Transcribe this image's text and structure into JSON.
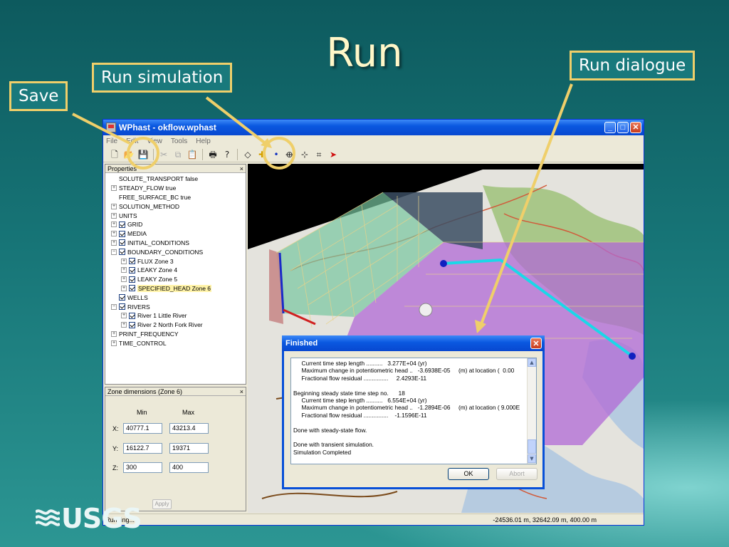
{
  "slide": {
    "title": "Run",
    "callouts": {
      "save": "Save",
      "run_simulation": "Run simulation",
      "run_dialogue": "Run dialogue"
    },
    "logo": "USGS"
  },
  "window": {
    "title": "WPhast - okflow.wphast",
    "menu": [
      "File",
      "Edit",
      "View",
      "Tools",
      "Help"
    ],
    "toolbar_icons": [
      "new-icon",
      "open-icon",
      "save-icon",
      "cut-icon",
      "copy-icon",
      "paste-icon",
      "print-icon",
      "help-icon",
      "zone-icon",
      "add-icon",
      "well-icon",
      "run-icon",
      "river-icon",
      "grid-icon",
      "pointer-icon"
    ]
  },
  "properties": {
    "header": "Properties",
    "close": "×",
    "items": [
      {
        "label": "SOLUTE_TRANSPORT false",
        "toggle": "",
        "checked": false,
        "indent": 0
      },
      {
        "label": "STEADY_FLOW true",
        "toggle": "+",
        "checked": false,
        "indent": 0
      },
      {
        "label": "FREE_SURFACE_BC true",
        "toggle": "",
        "checked": false,
        "indent": 0
      },
      {
        "label": "SOLUTION_METHOD",
        "toggle": "+",
        "checked": false,
        "indent": 0
      },
      {
        "label": "UNITS",
        "toggle": "+",
        "checked": false,
        "indent": 0
      },
      {
        "label": "GRID",
        "toggle": "+",
        "checked": true,
        "indent": 0
      },
      {
        "label": "MEDIA",
        "toggle": "+",
        "checked": true,
        "indent": 0
      },
      {
        "label": "INITIAL_CONDITIONS",
        "toggle": "+",
        "checked": true,
        "indent": 0
      },
      {
        "label": "BOUNDARY_CONDITIONS",
        "toggle": "−",
        "checked": true,
        "indent": 0
      },
      {
        "label": "FLUX Zone 3",
        "toggle": "+",
        "checked": true,
        "indent": 1
      },
      {
        "label": "LEAKY Zone 4",
        "toggle": "+",
        "checked": true,
        "indent": 1
      },
      {
        "label": "LEAKY Zone 5",
        "toggle": "+",
        "checked": true,
        "indent": 1
      },
      {
        "label": "SPECIFIED_HEAD Zone 6",
        "toggle": "+",
        "checked": true,
        "indent": 1,
        "selected": true
      },
      {
        "label": "WELLS",
        "toggle": "",
        "checked": true,
        "indent": 0
      },
      {
        "label": "RIVERS",
        "toggle": "−",
        "checked": true,
        "indent": 0
      },
      {
        "label": "River 1 Little River",
        "toggle": "+",
        "checked": true,
        "indent": 1
      },
      {
        "label": "River 2 North Fork River",
        "toggle": "+",
        "checked": true,
        "indent": 1
      },
      {
        "label": "PRINT_FREQUENCY",
        "toggle": "+",
        "checked": false,
        "indent": 0
      },
      {
        "label": "TIME_CONTROL",
        "toggle": "+",
        "checked": false,
        "indent": 0
      }
    ]
  },
  "zone": {
    "header": "Zone dimensions (Zone 6)",
    "close": "×",
    "min_label": "Min",
    "max_label": "Max",
    "x_label": "X:",
    "y_label": "Y:",
    "z_label": "Z:",
    "x_min": "40777.1",
    "x_max": "43213.4",
    "y_min": "16122.7",
    "y_max": "19371",
    "z_min": "300",
    "z_max": "400",
    "apply": "Apply"
  },
  "status": {
    "left": "Running...",
    "right": "-24536.01 m, 32642.09 m, 400.00 m"
  },
  "dialog": {
    "title": "Finished",
    "log": [
      "     Current time step length ..........   3.277E+04 (yr)",
      "     Maximum change in potentiometric head ..   -3.6938E-05     (m) at location (  0.00",
      "     Fractional flow residual ...............     2.4293E-11",
      "",
      "Beginning steady state time step no.      18",
      "     Current time step length ..........   6.554E+04 (yr)",
      "     Maximum change in potentiometric head ..   -1.2894E-06     (m) at location ( 9.000E",
      "     Fractional flow residual ...............    -1.1596E-11",
      "",
      "Done with steady-state flow.",
      "",
      "Done with transient simulation.",
      "Simulation Completed"
    ],
    "ok": "OK",
    "abort": "Abort"
  },
  "colors": {
    "highlight_ring": "#efcf6a",
    "xp_blue": "#0a58e0"
  }
}
